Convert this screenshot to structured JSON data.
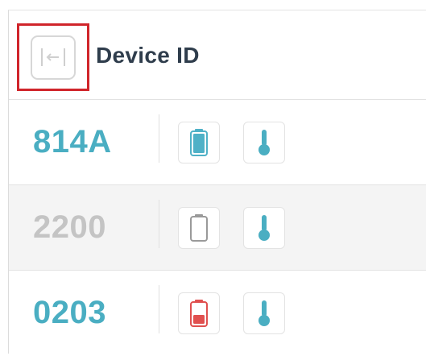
{
  "header": {
    "title": "Device ID",
    "collapse_icon": "collapse-arrow-icon"
  },
  "colors": {
    "active_id": "#4aaec2",
    "inactive_id": "#c4c4c4",
    "battery_full": "#4fb1c7",
    "battery_low": "#e0504f",
    "battery_empty_outline": "#9a9a9a",
    "thermometer": "#4aaec2",
    "highlight": "#d0252b"
  },
  "rows": [
    {
      "device_id": "814A",
      "status": "active",
      "battery_icon": "battery-full-icon",
      "temp_icon": "thermometer-icon"
    },
    {
      "device_id": "2200",
      "status": "inactive",
      "battery_icon": "battery-empty-icon",
      "temp_icon": "thermometer-icon"
    },
    {
      "device_id": "0203",
      "status": "active",
      "battery_icon": "battery-low-icon",
      "temp_icon": "thermometer-icon"
    }
  ]
}
